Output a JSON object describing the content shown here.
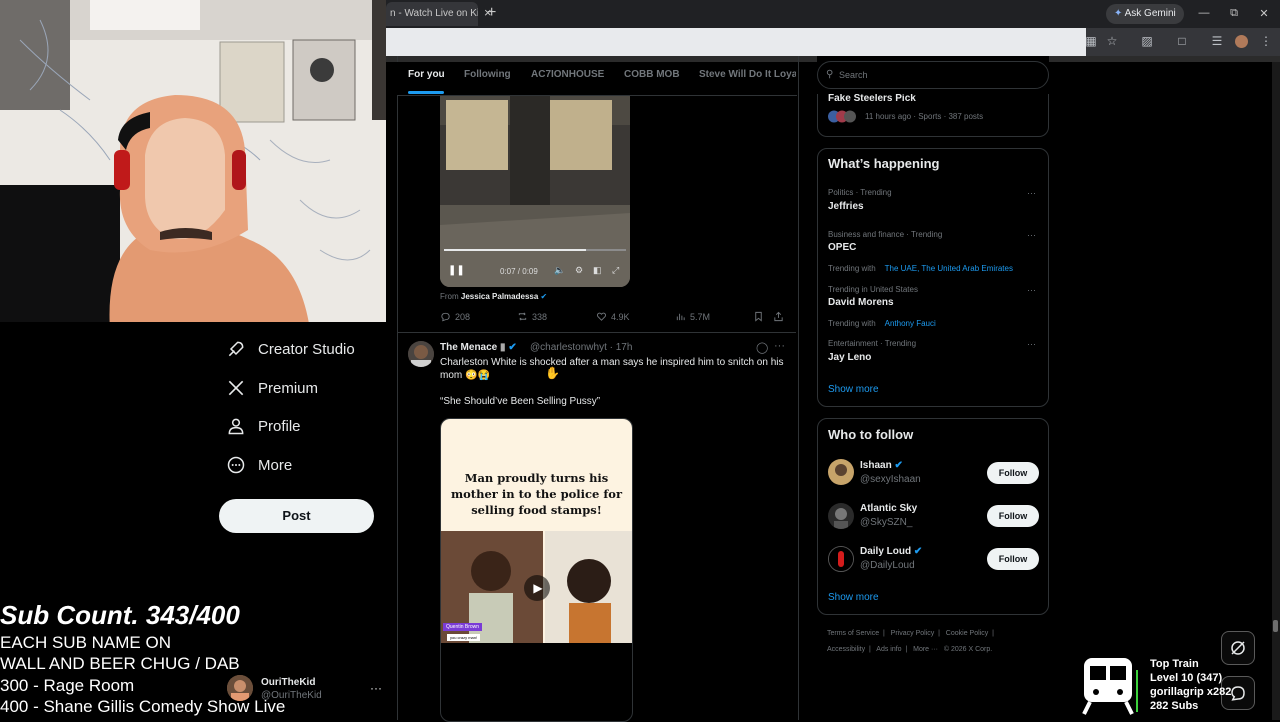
{
  "browser": {
    "tab_title": "n - Watch Live on Ki",
    "tab_close": "×",
    "new_tab": "+",
    "gemini_label": "Ask Gemini",
    "gemini_icon": "gemini-star-icon"
  },
  "feed_tabs": [
    "For you",
    "Following",
    "AC7IONHOUSE",
    "COBB MOB",
    "Steve Will Do It Loyal"
  ],
  "nav": [
    {
      "label": "Creator Studio",
      "icon": "creator-studio-icon"
    },
    {
      "label": "Premium",
      "icon": "x-logo-icon"
    },
    {
      "label": "Profile",
      "icon": "profile-icon"
    },
    {
      "label": "More",
      "icon": "more-circle-icon"
    }
  ],
  "post_button": "Post",
  "overlay": {
    "sub_count": "Sub Count. 343/400",
    "line1": "EACH SUB NAME ON",
    "line2": "WALL AND BEER CHUG / DAB",
    "line3": "300 - Rage Room",
    "line4": "400 - Shane Gillis Comedy Show Live"
  },
  "account": {
    "name": "OuriTheKid",
    "handle": "@OuriTheKid",
    "more": "···"
  },
  "post1": {
    "video_time": "0:07 / 0:09",
    "from_label": "From",
    "from_name": "Jessica Palmadessa",
    "replies": "208",
    "reposts": "338",
    "likes": "4.9K",
    "views": "5.7M",
    "video_progress": 0.78
  },
  "post2": {
    "name": "The Menace",
    "handle_time": "@charlestonwhyt · 17h",
    "text": "Charleston White is shocked after a man says he inspired him to snitch on his mom 😳😭",
    "quote": "“She Should’ve Been Selling Pussy”",
    "headline": "Man proudly turns his mother in to the police for selling food stamps!",
    "caption1": "Quentin Brown",
    "caption2": "you crazy man!"
  },
  "right": {
    "search_placeholder": "Search",
    "top_trend": {
      "name": "Fake Steelers Pick",
      "meta": "11 hours ago · Sports · 387 posts"
    },
    "happening_title": "What’s happening",
    "trends": [
      {
        "meta": "Politics · Trending",
        "name": "Jeffries",
        "with_label": "",
        "with_links": ""
      },
      {
        "meta": "Business and finance · Trending",
        "name": "OPEC",
        "with_label": "Trending with",
        "with_links": "The UAE, The United Arab Emirates"
      },
      {
        "meta": "Trending in United States",
        "name": "David Morens",
        "with_label": "Trending with",
        "with_links": "Anthony Fauci"
      },
      {
        "meta": "Entertainment · Trending",
        "name": "Jay Leno",
        "with_label": "",
        "with_links": ""
      }
    ],
    "show_more": "Show more",
    "wtf_title": "Who to follow",
    "follow": [
      {
        "name": "Ishaan",
        "handle": "@sexyIshaan",
        "verified": true
      },
      {
        "name": "Atlantic Sky",
        "handle": "@SkySZN_",
        "verified": false
      },
      {
        "name": "Daily Loud",
        "handle": "@DailyLoud",
        "verified": true
      }
    ],
    "follow_label": "Follow",
    "footer1": [
      "Terms of Service",
      "Privacy Policy",
      "Cookie Policy"
    ],
    "footer2": [
      "Accessibility",
      "Ads info",
      "More ···",
      "© 2026 X Corp."
    ]
  },
  "train": {
    "title": "Top Train",
    "level": "Level 10  (347)",
    "user": "gorillagrip x282",
    "subs": "282 Subs"
  },
  "colors": {
    "accent": "#1d9bf0",
    "hoodie": "#e39a72",
    "background": "#000000"
  }
}
